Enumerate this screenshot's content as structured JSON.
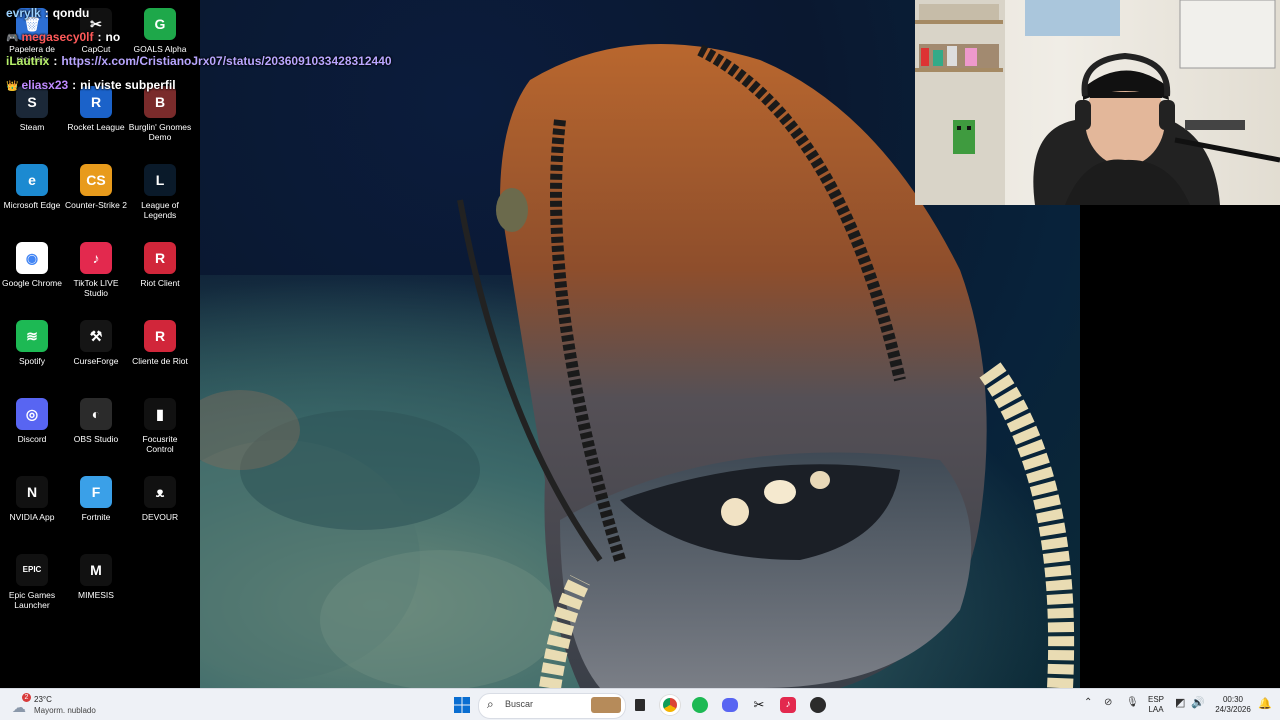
{
  "desktop_icons": [
    {
      "label": "Papelera de reciclaje",
      "col": 0,
      "row": 0,
      "bg": "#2d6fd4",
      "glyph": "🗑"
    },
    {
      "label": "CapCut",
      "col": 1,
      "row": 0,
      "bg": "#111111",
      "glyph": "✂"
    },
    {
      "label": "GOALS Alpha",
      "col": 2,
      "row": 0,
      "bg": "#1ea84a",
      "glyph": "G"
    },
    {
      "label": "Steam",
      "col": 0,
      "row": 1,
      "bg": "#1b2838",
      "glyph": "S"
    },
    {
      "label": "Rocket League",
      "col": 1,
      "row": 1,
      "bg": "#1b62c9",
      "glyph": "R"
    },
    {
      "label": "Burglin' Gnomes Demo",
      "col": 2,
      "row": 1,
      "bg": "#7a2b2b",
      "glyph": "B"
    },
    {
      "label": "Microsoft Edge",
      "col": 0,
      "row": 2,
      "bg": "#1c8ad1",
      "glyph": "e"
    },
    {
      "label": "Counter-Strike 2",
      "col": 1,
      "row": 2,
      "bg": "#e89b1c",
      "glyph": "CS"
    },
    {
      "label": "League of Legends",
      "col": 2,
      "row": 2,
      "bg": "#0a1a2a",
      "glyph": "L"
    },
    {
      "label": "Google Chrome",
      "col": 0,
      "row": 3,
      "bg": "#ffffff",
      "glyph": "◉"
    },
    {
      "label": "TikTok LIVE Studio",
      "col": 1,
      "row": 3,
      "bg": "#e3294e",
      "glyph": "♪"
    },
    {
      "label": "Riot Client",
      "col": 2,
      "row": 3,
      "bg": "#d1263a",
      "glyph": "R"
    },
    {
      "label": "Spotify",
      "col": 0,
      "row": 4,
      "bg": "#1db954",
      "glyph": "≋"
    },
    {
      "label": "CurseForge",
      "col": 1,
      "row": 4,
      "bg": "#151515",
      "glyph": "⚒"
    },
    {
      "label": "Cliente de Riot",
      "col": 2,
      "row": 4,
      "bg": "#d1263a",
      "glyph": "R"
    },
    {
      "label": "Discord",
      "col": 0,
      "row": 5,
      "bg": "#5865f2",
      "glyph": "◎"
    },
    {
      "label": "OBS Studio",
      "col": 1,
      "row": 5,
      "bg": "#2b2b2b",
      "glyph": "◐"
    },
    {
      "label": "Focusrite Control",
      "col": 2,
      "row": 5,
      "bg": "#111111",
      "glyph": "▮"
    },
    {
      "label": "NVIDIA App",
      "col": 0,
      "row": 6,
      "bg": "#111111",
      "glyph": "N"
    },
    {
      "label": "Fortnite",
      "col": 1,
      "row": 6,
      "bg": "#3aa0e8",
      "glyph": "F"
    },
    {
      "label": "DEVOUR",
      "col": 2,
      "row": 6,
      "bg": "#111111",
      "glyph": "ᴥ"
    },
    {
      "label": "Epic Games Launcher",
      "col": 0,
      "row": 7,
      "bg": "#111111",
      "glyph": "EPIC"
    },
    {
      "label": "MIMESIS",
      "col": 1,
      "row": 7,
      "bg": "#111111",
      "glyph": "M"
    }
  ],
  "chat": [
    {
      "user": "evrylk",
      "user_color": "#9bd2ff",
      "sep": ":",
      "msg": "qondu",
      "badge": ""
    },
    {
      "user": "megasecy0lf",
      "user_color": "#ff5a5a",
      "sep": ":",
      "msg": "no",
      "badge": "🎮"
    },
    {
      "user": "iLautrix",
      "user_color": "#b6f06a",
      "sep": ":",
      "msg": "https://x.com/CristianoJrx07/status/2036091033428312440",
      "msg_color": "#b9a6ff",
      "badge": ""
    },
    {
      "user": "eliasx23",
      "user_color": "#c08aff",
      "sep": ":",
      "msg": "ni viste subperfil",
      "badge": "👑"
    }
  ],
  "taskbar": {
    "weather_temp": "23°C",
    "weather_desc": "Mayorm. nublado",
    "weather_badge": "2",
    "search_placeholder": "Buscar",
    "lang_top": "ESP",
    "lang_bottom": "LAA",
    "time": "00:30",
    "date": "24/3/2026",
    "pinned": [
      "start",
      "search",
      "widget-game",
      "task-view",
      "chrome",
      "spotify",
      "discord",
      "capcut",
      "tiktok-live",
      "obs"
    ]
  },
  "colors": {
    "taskbar_bg": "#eef1f6",
    "accent": "#0067c0"
  }
}
